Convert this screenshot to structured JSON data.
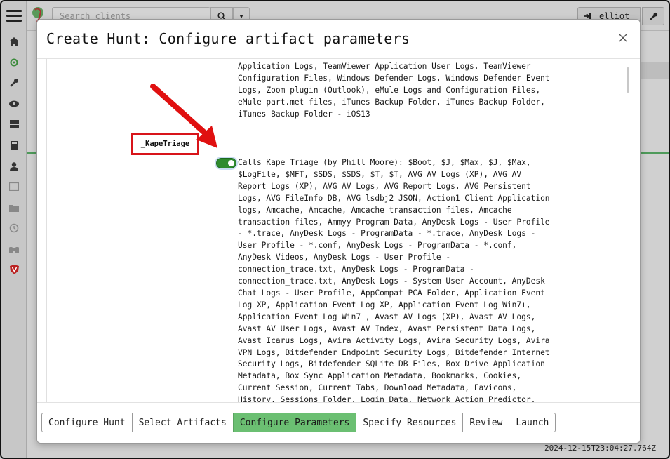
{
  "topbar": {
    "search_placeholder": "Search clients",
    "username": "elliot"
  },
  "timestamp": "2024-12-15T23:04:27.764Z",
  "modal": {
    "title": "Create Hunt: Configure artifact parameters",
    "previous_param_description": "Steam Friend List and Username History, Tele, Teamviewer\nApplication Logs, TeamViewer Application User Logs, TeamViewer\nConfiguration Files, Windows Defender Logs, Windows Defender Event\nLogs, Zoom plugin (Outlook), eMule Logs and Configuration Files,\neMule part.met files, iTunes Backup Folder, iTunes Backup Folder,\niTunes Backup Folder - iOS13",
    "param": {
      "name": "_KapeTriage",
      "enabled": true,
      "description": "Calls Kape Triage (by Phill Moore): $Boot, $J, $Max, $J, $Max,\n$LogFile, $MFT, $SDS, $SDS, $T, $T, AVG AV Logs (XP), AVG AV\nReport Logs (XP), AVG AV Logs, AVG Report Logs, AVG Persistent\nLogs, AVG FileInfo DB, AVG lsdbj2 JSON, Action1 Client Application\nlogs, Amcache, Amcache, Amcache transaction files, Amcache\ntransaction files, Ammyy Program Data, AnyDesk Logs - User Profile\n- *.trace, AnyDesk Logs - ProgramData - *.trace, AnyDesk Logs -\nUser Profile - *.conf, AnyDesk Logs - ProgramData - *.conf,\nAnyDesk Videos, AnyDesk Logs - User Profile -\nconnection_trace.txt, AnyDesk Logs - ProgramData -\nconnection_trace.txt, AnyDesk Logs - System User Account, AnyDesk\nChat Logs - User Profile, AppCompat PCA Folder, Application Event\nLog XP, Application Event Log XP, Application Event Log Win7+,\nApplication Event Log Win7+, Avast AV Logs (XP), Avast AV Logs,\nAvast AV User Logs, Avast AV Index, Avast Persistent Data Logs,\nAvast Icarus Logs, Avira Activity Logs, Avira Security Logs, Avira\nVPN Logs, Bitdefender Endpoint Security Logs, Bitdefender Internet\nSecurity Logs, Bitdefender SQLite DB Files, Box Drive Application\nMetadata, Box Sync Application Metadata, Bookmarks, Cookies,\nCurrent Session, Current Tabs, Download Metadata, Favicons,\nHistory, Sessions Folder, Login Data, Network Action Predictor,\nNetwork Persistent State, Preferences, Quota Manager, Reporting\nand NEL, Shortcuts, Publishers Info DB/Dcache, Domain, Top Sites"
    },
    "tabs": [
      {
        "label": "Configure Hunt",
        "active": false
      },
      {
        "label": "Select Artifacts",
        "active": false
      },
      {
        "label": "Configure Parameters",
        "active": true
      },
      {
        "label": "Specify Resources",
        "active": false
      },
      {
        "label": "Review",
        "active": false
      },
      {
        "label": "Launch",
        "active": false
      }
    ]
  },
  "colors": {
    "active_tab": "#6bbf72",
    "toggle_on": "#2e8b2e",
    "highlight_box": "#d8141a",
    "annotation_arrow": "#e01010"
  }
}
